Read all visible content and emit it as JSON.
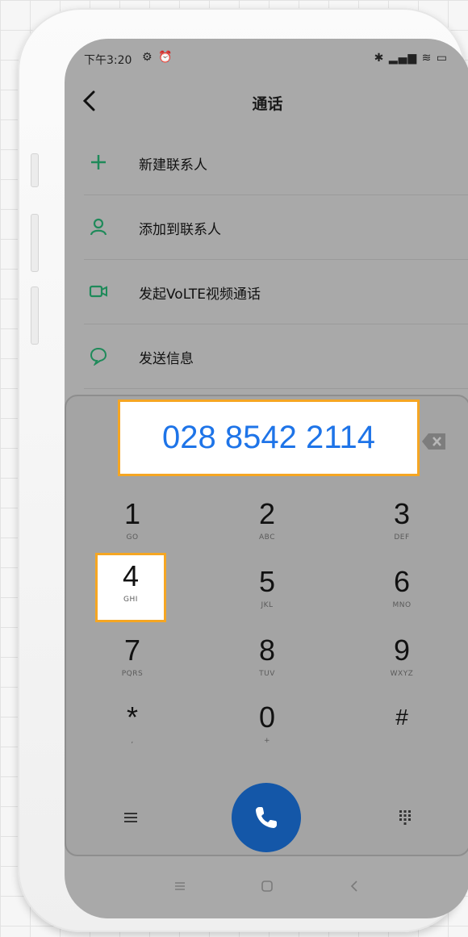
{
  "status_bar": {
    "time": "下午3:20",
    "left_icons": [
      "gear-icon",
      "alarm-icon"
    ],
    "right_icons": [
      "bluetooth-icon",
      "signal-icon",
      "wifi-icon",
      "battery-icon"
    ]
  },
  "header": {
    "title": "通话",
    "back_icon": "chevron-left-icon"
  },
  "menu": {
    "items": [
      {
        "label": "新建联系人",
        "icon": "plus-icon"
      },
      {
        "label": "添加到联系人",
        "icon": "person-icon"
      },
      {
        "label": "发起VoLTE视频通话",
        "icon": "video-icon"
      },
      {
        "label": "发送信息",
        "icon": "message-icon"
      }
    ]
  },
  "dialer": {
    "number": "028 8542 2114",
    "highlighted_key": "4",
    "keys": [
      {
        "digit": "1",
        "letters": "GO"
      },
      {
        "digit": "2",
        "letters": "ABC"
      },
      {
        "digit": "3",
        "letters": "DEF"
      },
      {
        "digit": "4",
        "letters": "GHI"
      },
      {
        "digit": "5",
        "letters": "JKL"
      },
      {
        "digit": "6",
        "letters": "MNO"
      },
      {
        "digit": "7",
        "letters": "PQRS"
      },
      {
        "digit": "8",
        "letters": "TUV"
      },
      {
        "digit": "9",
        "letters": "WXYZ"
      },
      {
        "digit": "*",
        "letters": ","
      },
      {
        "digit": "0",
        "letters": "+"
      },
      {
        "digit": "#",
        "letters": ""
      }
    ]
  },
  "colors": {
    "accent_green": "#1f8a5a",
    "number_blue": "#1e74e8",
    "highlight_orange": "#f5a623",
    "call_button": "#1457a8"
  }
}
